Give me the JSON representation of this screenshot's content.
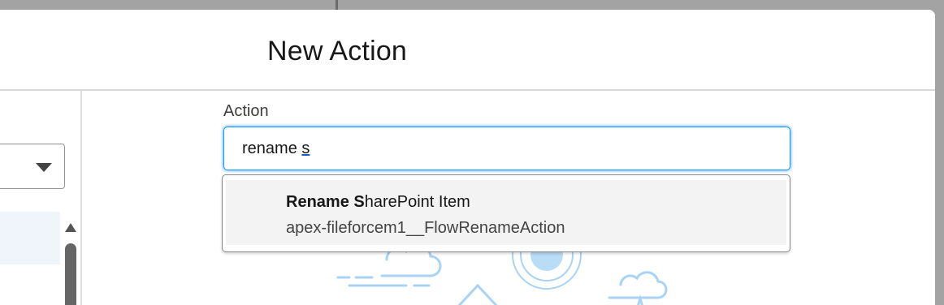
{
  "modal": {
    "title": "New Action"
  },
  "action_field": {
    "label": "Action",
    "value_prefix": "rename ",
    "value_tail": "s"
  },
  "dropdown": {
    "options": [
      {
        "title_match": "Rename S",
        "title_rest": "harePoint Item",
        "api_name": "apex-fileforcem1__FlowRenameAction"
      }
    ]
  },
  "colors": {
    "focus_ring": "#1b96ff",
    "backdrop": "#a3a3a3",
    "option_hover": "#f3f3f3",
    "illustration": "#a9d3f5"
  },
  "icons": {
    "left_select_caret": "chevron-down-icon",
    "scroll_up": "scroll-up-arrow-icon"
  }
}
